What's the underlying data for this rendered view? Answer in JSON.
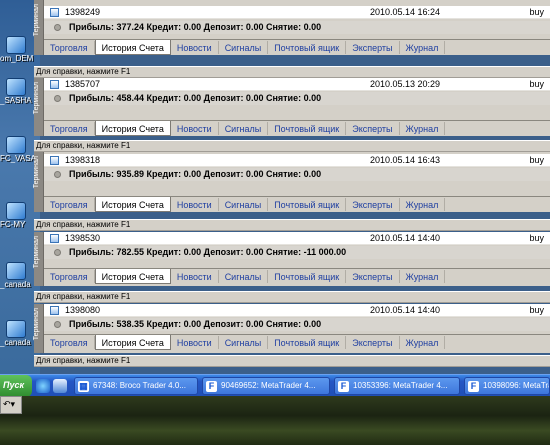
{
  "desktop": {
    "icons": [
      {
        "label": "om_DEM",
        "y": 0
      },
      {
        "label": "_SASHA",
        "y": 0
      },
      {
        "label": "FC_VASA",
        "y": 0
      },
      {
        "label": "FC-MY",
        "y": 0
      },
      {
        "label": "_canada",
        "y": 0
      },
      {
        "label": "_canada",
        "y": 0
      }
    ]
  },
  "terminal_label": "Терминал",
  "help_text": "Для справки, нажмите F1",
  "tabs": [
    "Торговля",
    "История Счета",
    "Новости",
    "Сигналы",
    "Почтовый ящик",
    "Эксперты",
    "Журнал"
  ],
  "panels": [
    {
      "order": "1398249",
      "time": "2010.05.14 16:24",
      "type": "buy",
      "summary": "Прибыль: 377.24  Кредит: 0.00  Депозит: 0.00  Снятие: 0.00"
    },
    {
      "order": "1385707",
      "time": "2010.05.13 20:29",
      "type": "buy",
      "summary": "Прибыль: 458.44  Кредит: 0.00  Депозит: 0.00  Снятие: 0.00"
    },
    {
      "order": "1398318",
      "time": "2010.05.14 16:43",
      "type": "buy",
      "summary": "Прибыль: 935.89  Кредит: 0.00  Депозит: 0.00  Снятие: 0.00"
    },
    {
      "order": "1398530",
      "time": "2010.05.14 14:40",
      "type": "buy",
      "summary": "Прибыль: 782.55  Кредит: 0.00  Депозит: 0.00  Снятие: -11 000.00"
    },
    {
      "order": "1398080",
      "time": "2010.05.14 14:40",
      "type": "buy",
      "summary": "Прибыль: 538.35  Кредит: 0.00  Депозит: 0.00  Снятие: 0.00"
    }
  ],
  "taskbar": {
    "start": "Пуск",
    "buttons": [
      "67348: Broco Trader 4.0...",
      "90469652: MetaTrader 4...",
      "10353396: MetaTrader 4...",
      "10398096: MetaTra"
    ]
  }
}
